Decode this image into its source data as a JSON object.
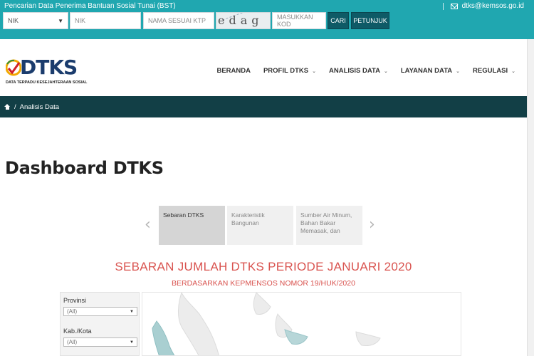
{
  "topbar": {
    "caption": "Pencarian Data Penerima Bantuan Sosial Tunai (BST)",
    "email": "dtks@kemsos.go.id",
    "search": {
      "type_select": "NIK",
      "nik_placeholder": "NIK",
      "nama_placeholder": "NAMA SESUAI KTP",
      "captcha_text": "edag",
      "kode_placeholder": "MASUKKAN KOD",
      "cari_label": "CARI",
      "petunjuk_label": "PETUNJUK"
    }
  },
  "logo": {
    "word": "DTKS",
    "tagline": "DATA TERPADU KESEJAHTERAAN SOSIAL"
  },
  "nav": {
    "items": [
      {
        "label": "BERANDA",
        "dropdown": false
      },
      {
        "label": "PROFIL DTKS",
        "dropdown": true
      },
      {
        "label": "ANALISIS DATA",
        "dropdown": true
      },
      {
        "label": "LAYANAN DATA",
        "dropdown": true
      },
      {
        "label": "REGULASI",
        "dropdown": true
      }
    ]
  },
  "breadcrumb": {
    "separator": "/",
    "current": "Analisis Data"
  },
  "page": {
    "title": "Dashboard DTKS"
  },
  "carousel": {
    "tabs": [
      {
        "label": "Sebaran DTKS",
        "active": true
      },
      {
        "label": "Karakteristik Bangunan",
        "active": false
      },
      {
        "label": "Sumber Air Minum, Bahan Bakar Memasak, dan",
        "active": false
      }
    ]
  },
  "dashboard": {
    "title": "SEBARAN JUMLAH DTKS PERIODE JANUARI 2020",
    "subtitle": "BERDASARKAN KEPMENSOS NOMOR 19/HUK/2020",
    "filters": [
      {
        "label": "Provinsi",
        "value": "(All)"
      },
      {
        "label": "Kab./Kota",
        "value": "(All)"
      }
    ]
  },
  "colors": {
    "topbar": "#20a7b0",
    "button": "#0e5a66",
    "breadcrumb": "#123f46",
    "accent_red": "#d9534f",
    "logo_blue": "#1b3c6d"
  }
}
